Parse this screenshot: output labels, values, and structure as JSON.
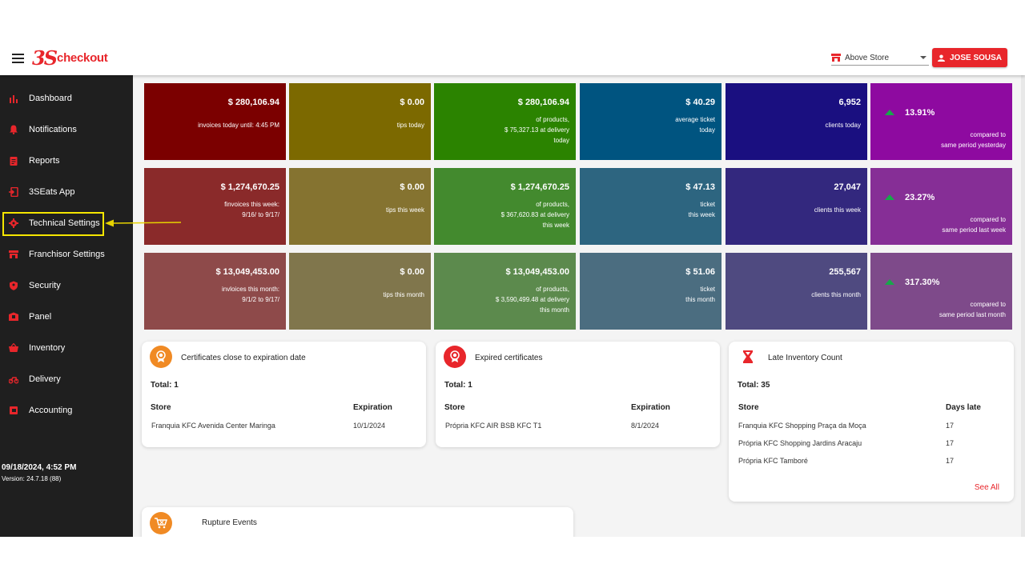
{
  "header": {
    "logo_mark": "3S",
    "logo_text": "checkout",
    "store_selector": "Above Store",
    "user_button": "JOSE SOUSA",
    "brand_color": "#e8262b"
  },
  "sidebar": {
    "items": [
      {
        "label": "Dashboard",
        "icon": "bar-chart-icon"
      },
      {
        "label": "Notifications",
        "icon": "bell-icon"
      },
      {
        "label": "Reports",
        "icon": "clipboard-icon"
      },
      {
        "label": "3SEats App",
        "icon": "phone-login-icon"
      },
      {
        "label": "Technical Settings",
        "icon": "gear-icon"
      },
      {
        "label": "Franchisor Settings",
        "icon": "store-icon"
      },
      {
        "label": "Security",
        "icon": "shield-icon"
      },
      {
        "label": "Panel",
        "icon": "panel-icon"
      },
      {
        "label": "Inventory",
        "icon": "basket-icon"
      },
      {
        "label": "Delivery",
        "icon": "motorcycle-icon"
      },
      {
        "label": "Accounting",
        "icon": "ledger-icon"
      }
    ],
    "datetime": "09/18/2024, 4:52 PM",
    "version": "Version: 24.7.18 (88)"
  },
  "kpis": {
    "today": {
      "invoices": {
        "value": "$ 280,106.94",
        "lines": [
          "invoices today until: 4:45 PM"
        ]
      },
      "tips": {
        "value": "$ 0.00",
        "lines": [
          "tips today"
        ]
      },
      "products": {
        "value": "$ 280,106.94",
        "lines": [
          "of products,",
          "$ 75,327.13 at delivery",
          "today"
        ]
      },
      "ticket": {
        "value": "$ 40.29",
        "lines": [
          "average ticket",
          "today"
        ]
      },
      "clients": {
        "value": "6,952",
        "lines": [
          "clients today"
        ]
      },
      "trend": {
        "value": "13.91%",
        "lines": [
          "compared to",
          "same period yesterday"
        ]
      }
    },
    "week": {
      "invoices": {
        "value": "$ 1,274,670.25",
        "lines": [
          "finvoices this week:",
          "9/16/ to 9/17/"
        ]
      },
      "tips": {
        "value": "$ 0.00",
        "lines": [
          "tips this week"
        ]
      },
      "products": {
        "value": "$ 1,274,670.25",
        "lines": [
          "of products,",
          "$ 367,620.83 at delivery",
          "this week"
        ]
      },
      "ticket": {
        "value": "$ 47.13",
        "lines": [
          "ticket",
          "this week"
        ]
      },
      "clients": {
        "value": "27,047",
        "lines": [
          "clients this week"
        ]
      },
      "trend": {
        "value": "23.27%",
        "lines": [
          "compared to",
          "same period last week"
        ]
      }
    },
    "month": {
      "invoices": {
        "value": "$ 13,049,453.00",
        "lines": [
          "invloices this month:",
          "9/1/2 to 9/17/"
        ]
      },
      "tips": {
        "value": "$ 0.00",
        "lines": [
          "tips this month"
        ]
      },
      "products": {
        "value": "$ 13,049,453.00",
        "lines": [
          "of products,",
          "$ 3,590,499.48 at delivery",
          "this month"
        ]
      },
      "ticket": {
        "value": "$ 51.06",
        "lines": [
          "ticket",
          "this month"
        ]
      },
      "clients": {
        "value": "255,567",
        "lines": [
          "clients this month"
        ]
      },
      "trend": {
        "value": "317.30%",
        "lines": [
          "compared to",
          "same period last month"
        ]
      }
    }
  },
  "certs_expiring": {
    "title": "Certificates close to expiration date",
    "total_label": "Total:",
    "total": "1",
    "col_store": "Store",
    "col_expiration": "Expiration",
    "rows": [
      {
        "store": "Franquia KFC Avenida Center Maringa",
        "expiration": "10/1/2024"
      }
    ]
  },
  "certs_expired": {
    "title": "Expired certificates",
    "total_label": "Total:",
    "total": "1",
    "col_store": "Store",
    "col_expiration": "Expiration",
    "rows": [
      {
        "store": "Própria KFC AIR BSB KFC T1",
        "expiration": "8/1/2024"
      }
    ]
  },
  "late_inventory": {
    "title": "Late Inventory Count",
    "total_label": "Total:",
    "total": "35",
    "col_store": "Store",
    "col_days": "Days late",
    "rows": [
      {
        "store": "Franquia KFC Shopping Praça da Moça",
        "days": "17"
      },
      {
        "store": "Própria KFC Shopping Jardins Aracaju",
        "days": "17"
      },
      {
        "store": "Própria KFC Tamboré",
        "days": "17"
      }
    ],
    "see_all": "See All"
  },
  "rupture": {
    "title": "Rupture Events"
  }
}
